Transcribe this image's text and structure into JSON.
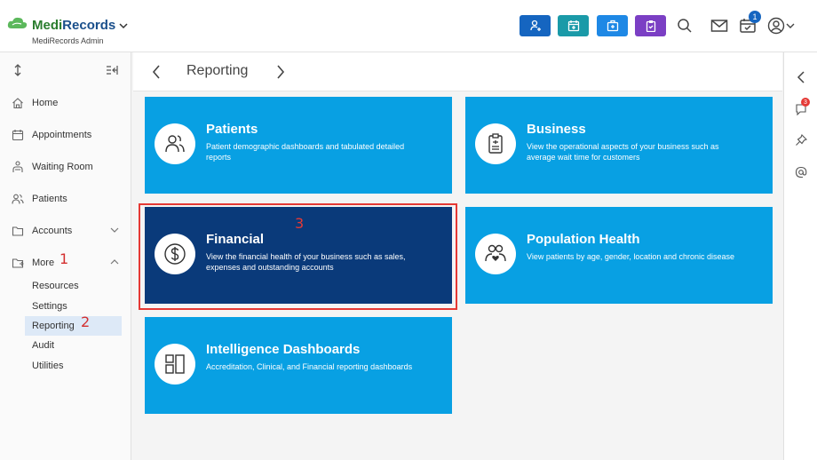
{
  "app": {
    "name_part1": "Medi",
    "name_part2": "Records",
    "subtitle": "MediRecords Admin"
  },
  "topbar": {
    "notification_count": "1",
    "buttons": [
      {
        "icon": "add-patient-icon",
        "color": "#1565c0"
      },
      {
        "icon": "calendar-add-icon",
        "color": "#1a9aa8"
      },
      {
        "icon": "medical-kit-icon",
        "color": "#1e88e5"
      },
      {
        "icon": "clipboard-icon",
        "color": "#7b3fc4"
      }
    ]
  },
  "sidebar": {
    "items": [
      {
        "label": "Home",
        "icon": "home-icon"
      },
      {
        "label": "Appointments",
        "icon": "calendar-icon"
      },
      {
        "label": "Waiting Room",
        "icon": "waiting-room-icon"
      },
      {
        "label": "Patients",
        "icon": "patients-icon"
      },
      {
        "label": "Accounts",
        "icon": "folder-icon"
      },
      {
        "label": "More",
        "icon": "folder-open-icon"
      }
    ],
    "subitems": [
      "Resources",
      "Settings",
      "Reporting",
      "Audit",
      "Utilities"
    ]
  },
  "annotations": {
    "step1": "1",
    "step2": "2",
    "step3": "3"
  },
  "header": {
    "title": "Reporting"
  },
  "right_rail": {
    "chat_count": "3"
  },
  "cards": [
    {
      "title": "Patients",
      "desc": "Patient demographic dashboards and tabulated detailed reports",
      "icon": "patients-icon"
    },
    {
      "title": "Business",
      "desc": "View the operational aspects of your business such as average wait time for customers",
      "icon": "clipboard-icon"
    },
    {
      "title": "Financial",
      "desc": "View the financial health of your business such as sales, expenses and outstanding accounts",
      "icon": "dollar-icon"
    },
    {
      "title": "Population Health",
      "desc": "View patients by age, gender, location and chronic disease",
      "icon": "population-icon"
    },
    {
      "title": "Intelligence Dashboards",
      "desc": "Accreditation, Clinical, and Financial reporting dashboards",
      "icon": "dashboard-icon"
    }
  ]
}
